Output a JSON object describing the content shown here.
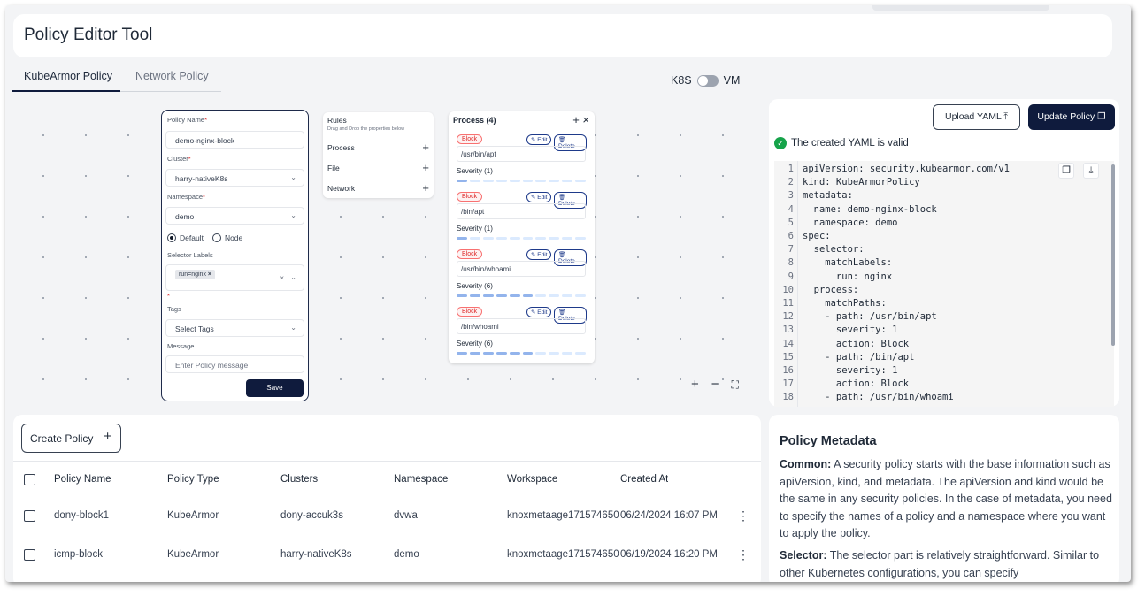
{
  "header": {
    "title": "Policy Editor Tool"
  },
  "tabs": [
    {
      "label": "KubeArmor Policy",
      "active": true
    },
    {
      "label": "Network Policy",
      "active": false
    }
  ],
  "toggle": {
    "left": "K8S",
    "right": "VM"
  },
  "form": {
    "policy_name_label": "Policy Name",
    "policy_name_value": "demo-nginx-block",
    "cluster_label": "Cluster",
    "cluster_value": "harry-nativeK8s",
    "namespace_label": "Namespace",
    "namespace_value": "demo",
    "radio_default": "Default",
    "radio_node": "Node",
    "selector_labels_label": "Selector Labels",
    "selector_chip": "run=nginx",
    "tags_label": "Tags",
    "tags_placeholder": "Select Tags",
    "message_label": "Message",
    "message_placeholder": "Enter Policy message",
    "save_label": "Save",
    "required_mark": "*"
  },
  "rules": {
    "title": "Rules",
    "subtitle": "Drag and Drop the properties below",
    "items": [
      "Process",
      "File",
      "Network"
    ]
  },
  "process": {
    "title": "Process (4)",
    "action_label": "Block",
    "edit_label": "Edit",
    "delete_label": "Delete",
    "items": [
      {
        "path": "/usr/bin/apt",
        "severity_label": "Severity (1)",
        "severity": 1
      },
      {
        "path": "/bin/apt",
        "severity_label": "Severity (1)",
        "severity": 1
      },
      {
        "path": "/usr/bin/whoami",
        "severity_label": "Severity (6)",
        "severity": 6
      },
      {
        "path": "/bin/whoami",
        "severity_label": "Severity (6)",
        "severity": 6
      }
    ]
  },
  "yaml": {
    "upload_label": "Upload YAML",
    "update_label": "Update Policy",
    "valid_text": "The created YAML is valid",
    "lines": [
      "apiVersion: security.kubearmor.com/v1",
      "kind: KubeArmorPolicy",
      "metadata:",
      "  name: demo-nginx-block",
      "  namespace: demo",
      "spec:",
      "  selector:",
      "    matchLabels:",
      "      run: nginx",
      "  process:",
      "    matchPaths:",
      "    - path: /usr/bin/apt",
      "      severity: 1",
      "      action: Block",
      "    - path: /bin/apt",
      "      severity: 1",
      "      action: Block",
      "    - path: /usr/bin/whoami"
    ]
  },
  "table": {
    "create_label": "Create Policy",
    "columns": [
      "Policy Name",
      "Policy Type",
      "Clusters",
      "Namespace",
      "Workspace",
      "Created At"
    ],
    "rows": [
      [
        "dony-block1",
        "KubeArmor",
        "dony-accuk3s",
        "dvwa",
        "knoxmetaage1715746500",
        "06/24/2024 16:07 PM"
      ],
      [
        "icmp-block",
        "KubeArmor",
        "harry-nativeK8s",
        "demo",
        "knoxmetaage1715746500",
        "06/19/2024 16:20 PM"
      ]
    ]
  },
  "metadata_panel": {
    "title": "Policy Metadata",
    "common_label": "Common:",
    "common_text": " A security policy starts with the base information such as apiVersion, kind, and metadata. The apiVersion and kind would be the same in any security policies. In the case of metadata, you need to specify the names of a policy and a namespace where you want to apply the policy.",
    "selector_label": "Selector:",
    "selector_text": " The selector part is relatively straightforward. Similar to other Kubernetes configurations, you can specify"
  },
  "colors": {
    "primary": "#0f1b3d",
    "valid": "#16a34a",
    "block": "#dc2626"
  }
}
